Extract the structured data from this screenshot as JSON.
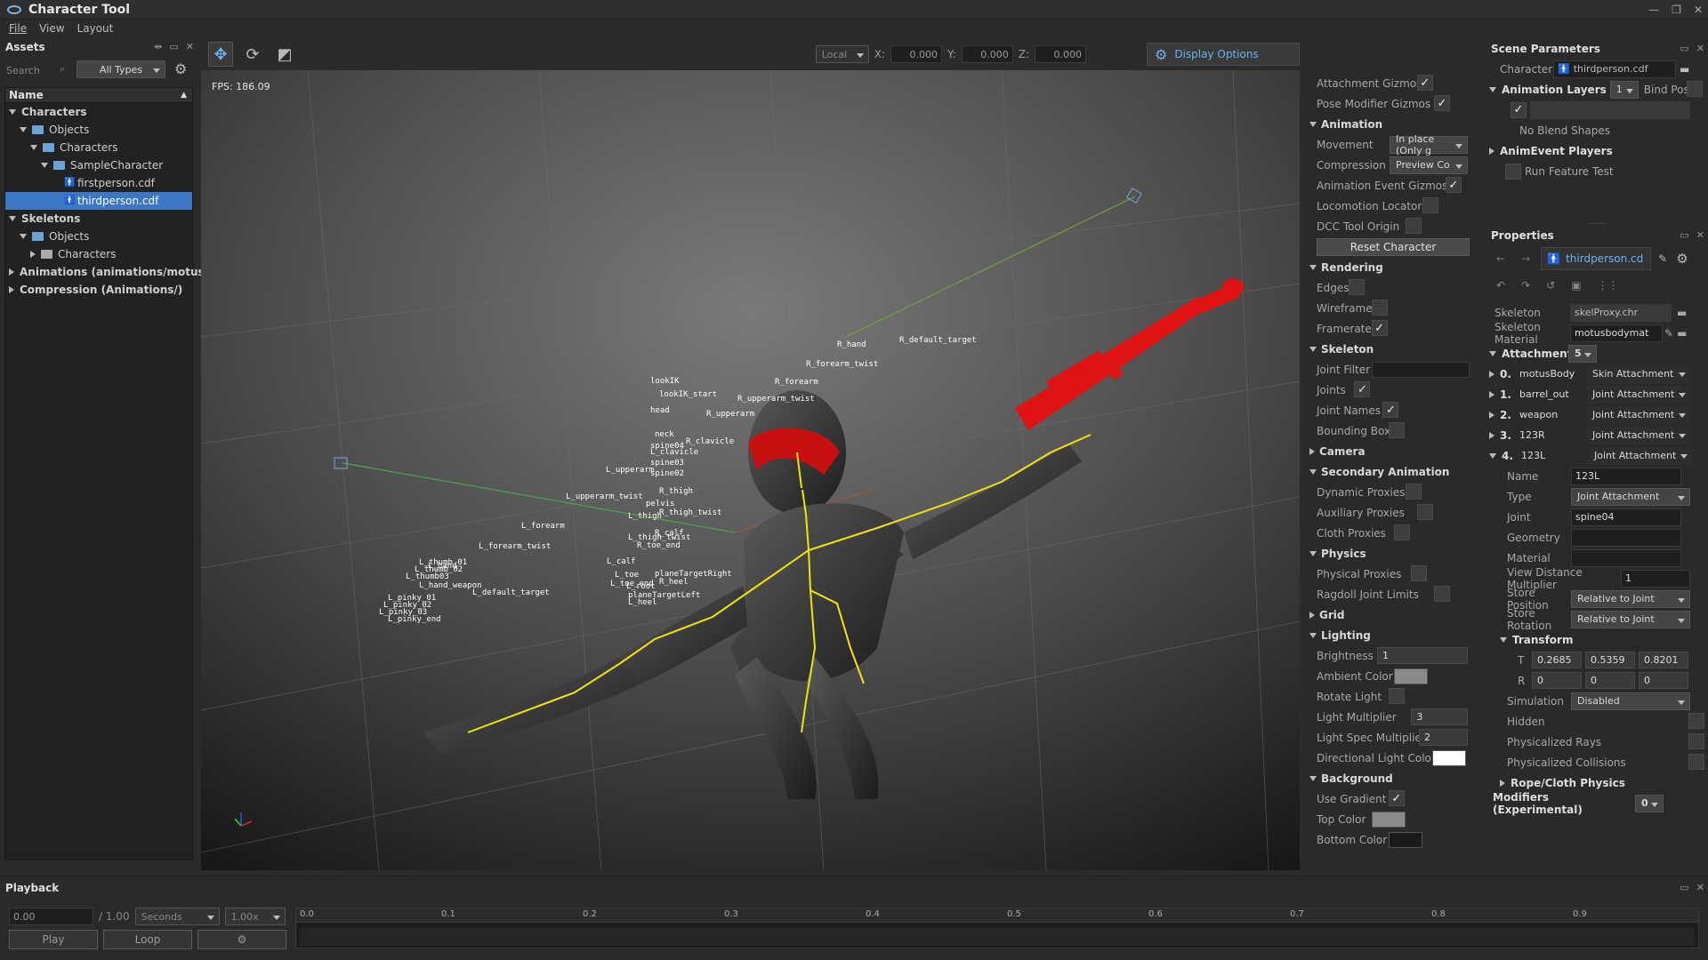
{
  "window": {
    "title": "Character Tool",
    "controls": [
      "—",
      "❐",
      "✕"
    ]
  },
  "menu": [
    "File",
    "View",
    "Layout"
  ],
  "assets": {
    "title": "Assets",
    "search_placeholder": "Search",
    "filter": "All Types",
    "column": "Name",
    "tree": [
      {
        "label": "Characters",
        "level": 0,
        "expanded": true,
        "type": "root"
      },
      {
        "label": "Objects",
        "level": 1,
        "expanded": true,
        "type": "folder"
      },
      {
        "label": "Characters",
        "level": 2,
        "expanded": true,
        "type": "folder"
      },
      {
        "label": "SampleCharacter",
        "level": 3,
        "expanded": true,
        "type": "folder"
      },
      {
        "label": "firstperson.cdf",
        "level": 4,
        "type": "file"
      },
      {
        "label": "thirdperson.cdf",
        "level": 4,
        "type": "file",
        "selected": true
      },
      {
        "label": "Skeletons",
        "level": 0,
        "expanded": true,
        "type": "root"
      },
      {
        "label": "Objects",
        "level": 1,
        "expanded": true,
        "type": "folder"
      },
      {
        "label": "Characters",
        "level": 2,
        "expanded": false,
        "type": "folder-grey"
      },
      {
        "label": "Animations (animations/motusa…",
        "level": 0,
        "expanded": false,
        "type": "root"
      },
      {
        "label": "Compression (Animations/)",
        "level": 0,
        "expanded": false,
        "type": "root"
      }
    ]
  },
  "viewport_toolbar": {
    "space": "Local",
    "x_label": "X:",
    "x": "0.000",
    "y_label": "Y:",
    "y": "0.000",
    "z_label": "Z:",
    "z": "0.000",
    "display_options": "Display Options"
  },
  "viewport": {
    "fps": "FPS: 186.09",
    "bone_labels": [
      "lookIK",
      "lookIK_start",
      "head",
      "neck",
      "R_clavicle",
      "spine04",
      "L_clavicle",
      "spine03",
      "spine02",
      "L_upperarm",
      "R_upperarm",
      "R_upperarm_twist",
      "R_forearm",
      "R_forearm_twist",
      "R_hand",
      "L_upperarm_twist",
      "L_forearm",
      "L_forearm_twist",
      "L_hand",
      "R_thigh",
      "pelvis",
      "L_thigh",
      "R_thigh_twist",
      "R_calf",
      "L_thigh_twist",
      "R_toe_end",
      "L_calf",
      "L_toe",
      "planeTargetRight",
      "L_toe_end",
      "R_heel",
      "L_root",
      "planeTargetLeft",
      "L_heel",
      "L_thumb_01",
      "L_thumb_02",
      "L_thumb03",
      "L_hand_weapon",
      "L_default_target",
      "L_pinky_01",
      "L_pinky_02",
      "L_pinky_03",
      "L_pinky_end",
      "R_default_target"
    ]
  },
  "display_options": {
    "rows": [
      {
        "kind": "row",
        "label": "Attachment Gizmos",
        "control": "check",
        "checked": true
      },
      {
        "kind": "row",
        "label": "Pose Modifier Gizmos",
        "control": "check",
        "checked": true
      },
      {
        "kind": "section",
        "label": "Animation",
        "expanded": true
      },
      {
        "kind": "row",
        "label": "Movement",
        "control": "dropdown",
        "value": "In place (Only g"
      },
      {
        "kind": "row",
        "label": "Compression",
        "control": "dropdown",
        "value": "Preview Co"
      },
      {
        "kind": "row",
        "label": "Animation Event Gizmos",
        "control": "check",
        "checked": true
      },
      {
        "kind": "row",
        "label": "Locomotion Locator",
        "control": "check",
        "checked": false
      },
      {
        "kind": "row",
        "label": "DCC Tool Origin",
        "control": "check",
        "checked": false
      },
      {
        "kind": "button",
        "label": "Reset Character"
      },
      {
        "kind": "section",
        "label": "Rendering",
        "expanded": true
      },
      {
        "kind": "row",
        "label": "Edges",
        "control": "check",
        "checked": false
      },
      {
        "kind": "row",
        "label": "Wireframe",
        "control": "check",
        "checked": false
      },
      {
        "kind": "row",
        "label": "Framerate",
        "control": "check",
        "checked": true
      },
      {
        "kind": "section",
        "label": "Skeleton",
        "expanded": true
      },
      {
        "kind": "row",
        "label": "Joint Filter",
        "control": "text",
        "value": ""
      },
      {
        "kind": "row",
        "label": "Joints",
        "control": "check",
        "checked": true
      },
      {
        "kind": "row",
        "label": "Joint Names",
        "control": "check",
        "checked": true
      },
      {
        "kind": "row",
        "label": "Bounding Box",
        "control": "check",
        "checked": false
      },
      {
        "kind": "section",
        "label": "Camera",
        "expanded": false
      },
      {
        "kind": "section",
        "label": "Secondary Animation",
        "expanded": true
      },
      {
        "kind": "row",
        "label": "Dynamic Proxies",
        "control": "check",
        "checked": false
      },
      {
        "kind": "row",
        "label": "Auxiliary Proxies",
        "control": "check",
        "checked": false
      },
      {
        "kind": "row",
        "label": "Cloth Proxies",
        "control": "check",
        "checked": false
      },
      {
        "kind": "section",
        "label": "Physics",
        "expanded": true
      },
      {
        "kind": "row",
        "label": "Physical Proxies",
        "control": "check",
        "checked": false
      },
      {
        "kind": "row",
        "label": "Ragdoll Joint Limits",
        "control": "check",
        "checked": false
      },
      {
        "kind": "section",
        "label": "Grid",
        "expanded": false
      },
      {
        "kind": "section",
        "label": "Lighting",
        "expanded": true
      },
      {
        "kind": "row",
        "label": "Brightness",
        "control": "spin",
        "value": "1"
      },
      {
        "kind": "row",
        "label": "Ambient Color",
        "control": "color",
        "color": "#8a8a8a"
      },
      {
        "kind": "row",
        "label": "Rotate Light",
        "control": "check",
        "checked": false
      },
      {
        "kind": "row",
        "label": "Light Multiplier",
        "control": "spin",
        "value": "3"
      },
      {
        "kind": "row",
        "label": "Light Spec Multiplier",
        "control": "spin",
        "value": "2"
      },
      {
        "kind": "row",
        "label": "Directional Light Color",
        "control": "color",
        "color": "#ffffff"
      },
      {
        "kind": "section",
        "label": "Background",
        "expanded": true
      },
      {
        "kind": "row",
        "label": "Use Gradient",
        "control": "check",
        "checked": true
      },
      {
        "kind": "row",
        "label": "Top Color",
        "control": "color",
        "color": "#8a8a8a"
      },
      {
        "kind": "row",
        "label": "Bottom Color",
        "control": "color",
        "color": "#1a1a1a"
      }
    ]
  },
  "scene_params": {
    "title": "Scene Parameters",
    "character_label": "Character",
    "character_value": "thirdperson.cdf",
    "anim_layers_label": "Animation Layers",
    "anim_layers_value": "1",
    "bind_pose_label": "Bind Pose",
    "no_blend": "No Blend Shapes",
    "anim_event_players": "AnimEvent Players",
    "run_feature_test": "Run Feature Test"
  },
  "properties": {
    "title": "Properties",
    "target": "thirdperson.cd",
    "skeleton_label": "Skeleton",
    "skeleton_value": "skelProxy.chr",
    "skeleton_material_label": "Skeleton Material",
    "skeleton_material_value": "motusbodymat",
    "attachments_label": "Attachments",
    "attachments_count": "5",
    "attachments": [
      {
        "idx": "0.",
        "name": "motusBody",
        "type": "Skin Attachment",
        "expanded": false
      },
      {
        "idx": "1.",
        "name": "barrel_out",
        "type": "Joint Attachment",
        "expanded": false
      },
      {
        "idx": "2.",
        "name": "weapon",
        "type": "Joint Attachment",
        "expanded": false
      },
      {
        "idx": "3.",
        "name": "123R",
        "type": "Joint Attachment",
        "expanded": false
      },
      {
        "idx": "4.",
        "name": "123L",
        "type": "Joint Attachment",
        "expanded": true
      }
    ],
    "detail": {
      "name_label": "Name",
      "name_value": "123L",
      "type_label": "Type",
      "type_value": "Joint Attachment",
      "joint_label": "Joint",
      "joint_value": "spine04",
      "geometry_label": "Geometry",
      "material_label": "Material",
      "view_distance_label": "View Distance Multiplier",
      "view_distance_value": "1",
      "store_position_label": "Store Position",
      "store_position_value": "Relative to Joint",
      "store_rotation_label": "Store Rotation",
      "store_rotation_value": "Relative to Joint",
      "transform_label": "Transform",
      "t_label": "T",
      "t_values": [
        "0.2685",
        "0.5359",
        "0.8201"
      ],
      "r_label": "R",
      "r_values": [
        "0",
        "0",
        "0"
      ],
      "simulation_label": "Simulation",
      "simulation_value": "Disabled",
      "hidden_label": "Hidden",
      "phys_rays_label": "Physicalized Rays",
      "phys_collisions_label": "Physicalized Collisions",
      "rope_cloth_label": "Rope/Cloth Physics"
    },
    "modifiers_label": "Modifiers (Experimental)",
    "modifiers_value": "0"
  },
  "playback": {
    "title": "Playback",
    "time": "0.00",
    "total": "/ 1.00",
    "unit": "Seconds",
    "speed": "1.00x",
    "play": "Play",
    "loop": "Loop",
    "ticks": [
      "0.0",
      "0.1",
      "0.2",
      "0.3",
      "0.4",
      "0.5",
      "0.6",
      "0.7",
      "0.8",
      "0.9"
    ]
  }
}
